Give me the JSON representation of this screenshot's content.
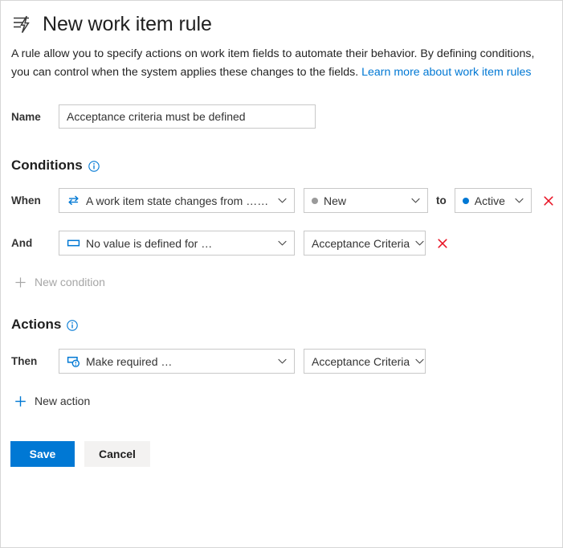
{
  "header": {
    "icon": "rule-lightning-icon",
    "title": "New work item rule"
  },
  "description": {
    "text": "A rule allow you to specify actions on work item fields to automate their behavior. By defining conditions, you can control when the system applies these changes to the fields. ",
    "link_text": "Learn more about work item rules",
    "link_color": "#0078d4"
  },
  "name_field": {
    "label": "Name",
    "value": "Acceptance criteria must be defined",
    "placeholder": "Name"
  },
  "conditions": {
    "heading": "Conditions",
    "info_icon": "info-circle-icon",
    "rows": [
      {
        "label": "When",
        "icon": "state-transition-icon",
        "condition_text": "A work item state changes from … to …",
        "from_state": "New",
        "from_state_color": "#9a9a9a",
        "to_label": "to",
        "to_state": "Active",
        "to_state_color": "#0078d4",
        "delete_icon": "close-x-icon"
      },
      {
        "label": "And",
        "icon": "empty-field-icon",
        "condition_text": "No value is defined for …",
        "field": "Acceptance Criteria",
        "delete_icon": "close-x-icon"
      }
    ],
    "add_link": {
      "icon": "plus-icon",
      "label": "New condition",
      "color": "#a6a6a6"
    }
  },
  "actions": {
    "heading": "Actions",
    "info_icon": "info-circle-icon",
    "rows": [
      {
        "label": "Then",
        "icon": "make-required-icon",
        "action_text": "Make required …",
        "field": "Acceptance Criteria"
      }
    ],
    "add_link": {
      "icon": "plus-icon",
      "label": "New action",
      "color": "#0078d4"
    }
  },
  "footer": {
    "save_label": "Save",
    "cancel_label": "Cancel",
    "save_color": "#0078d4",
    "cancel_color": "#f3f2f1"
  },
  "chevron_icon": "chevron-down-icon"
}
